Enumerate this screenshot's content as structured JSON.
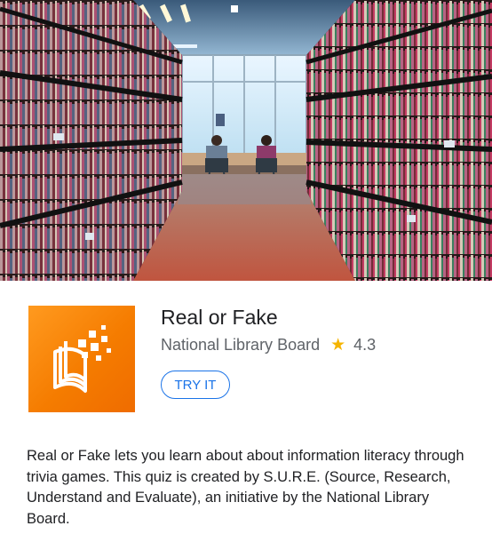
{
  "app": {
    "title": "Real or Fake",
    "developer": "National Library Board",
    "rating": "4.3",
    "icon": "real-or-fake-logo",
    "action_label": "TRY IT",
    "accent_color": "#1a73e8",
    "icon_color": "#f57c00",
    "star_color": "#f5b400"
  },
  "hero": {
    "icon": "library-bookshelves-photo"
  },
  "description": "Real or Fake lets you learn about about information literacy through trivia games. This quiz is created by S.U.R.E. (Source, Research, Understand and Evaluate), an initiative by the National Library Board."
}
